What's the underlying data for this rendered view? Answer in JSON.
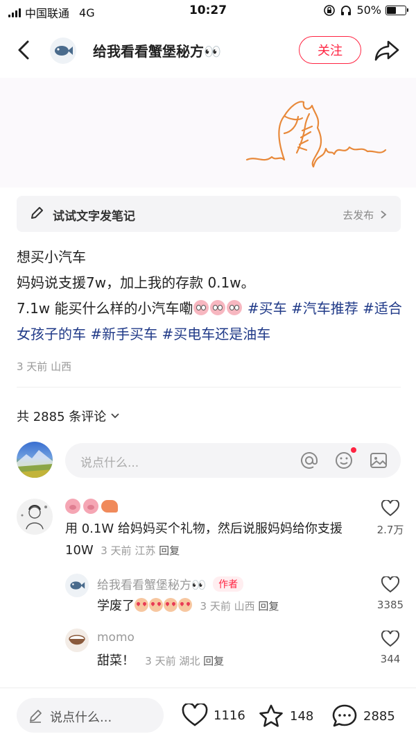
{
  "status_bar": {
    "carrier": "中国联通",
    "network": "4G",
    "time": "10:27",
    "battery": "50%",
    "battery_level": 0.5
  },
  "nav": {
    "back_icon": "chevron-left-icon",
    "author_name": "给我看看蟹堡秘方👀",
    "follow_label": "关注",
    "share_icon": "share-icon"
  },
  "try_note": {
    "label": "试试文字发笔记",
    "action": "去发布"
  },
  "post": {
    "line1": "想买小汽车",
    "line2": "妈妈说支援7w，加上我的存款 0.1w。",
    "line3_text": "7.1w 能买什么样的小汽车嘞",
    "tags": [
      "#买车",
      "#汽车推荐",
      "#适合女孩子的车",
      "#新手买车",
      "#买电车还是油车"
    ],
    "meta": "3 天前 山西"
  },
  "comments_header": {
    "count_label": "共 2885 条评论"
  },
  "comment_input": {
    "placeholder": "说点什么..."
  },
  "comments": [
    {
      "name": "",
      "text": "用 0.1W 给妈妈买个礼物，然后说服妈妈给你支援 10W",
      "time": "3 天前",
      "location": "江苏",
      "reply": "回复",
      "likes": "2.7万"
    },
    {
      "name": "给我看看蟹堡秘方👀",
      "badge": "作者",
      "text": "学废了",
      "time": "3 天前",
      "location": "山西",
      "reply": "回复",
      "likes": "3385"
    },
    {
      "name": "momo",
      "text": "甜菜！",
      "time": "3 天前",
      "location": "湖北",
      "reply": "回复",
      "likes": "344"
    }
  ],
  "bottom_bar": {
    "input_placeholder": "说点什么...",
    "likes": "1116",
    "collects": "148",
    "comments": "2885"
  },
  "colors": {
    "accent": "#ff2442",
    "hashtag": "#203a88",
    "doodle": "#e8893a"
  }
}
